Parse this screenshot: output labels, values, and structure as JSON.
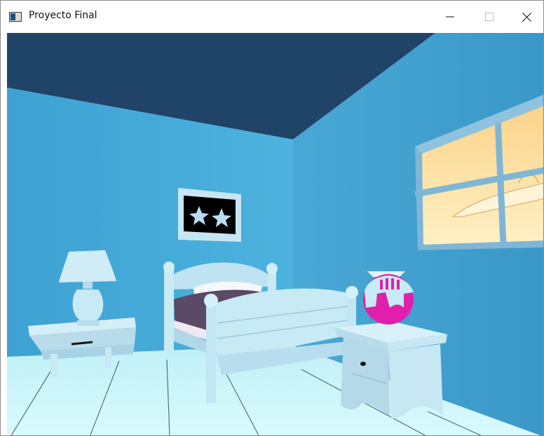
{
  "window": {
    "title": "Proyecto Final",
    "icon": "window-app-icon",
    "controls": {
      "minimize": "minimize-icon",
      "maximize": "maximize-icon",
      "close": "close-icon"
    }
  },
  "scene": {
    "objects": [
      "ceiling",
      "left-wall",
      "right-wall",
      "floor",
      "window-with-sky",
      "star-picture-frame",
      "table-lamp",
      "left-nightstand",
      "bed",
      "right-nightstand",
      "magenta-globe-vase"
    ],
    "colors": {
      "ceiling": "#1f4468",
      "left_wall": "#45a9d8",
      "right_wall": "#3f9ecf",
      "floor": "#cef7fb",
      "furniture": "#c7eaf5",
      "sky": "#fbd88c",
      "frame_inner": "#000000",
      "vase": "#e020ac",
      "duvet": "#5a4a66"
    }
  }
}
